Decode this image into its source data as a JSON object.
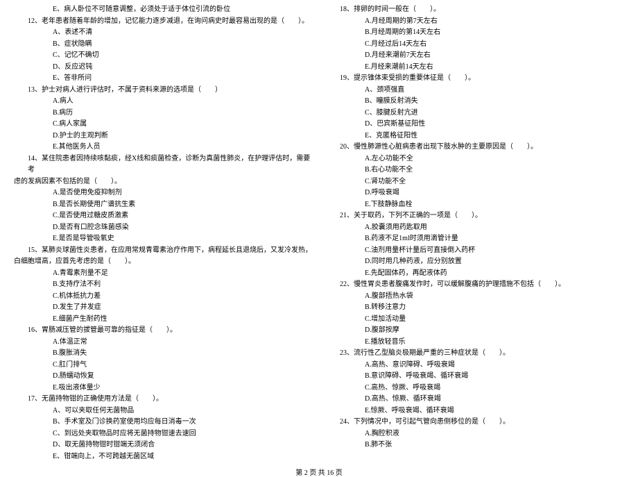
{
  "left": [
    {
      "type": "option",
      "text": "E、病人卧位不可随意调整，必须处于适于体位引流的卧位"
    },
    {
      "type": "question",
      "text": "12、老年患者随着年龄的增加，记忆能力逐步减退，在询问病史时最容易出现的是（　　）。"
    },
    {
      "type": "option",
      "text": "A、表述不清"
    },
    {
      "type": "option",
      "text": "B、症状隐瞒"
    },
    {
      "type": "option",
      "text": "C、记忆不确切"
    },
    {
      "type": "option",
      "text": "D、反应迟钝"
    },
    {
      "type": "option",
      "text": "E、答非所问"
    },
    {
      "type": "question",
      "text": "13、护士对病人进行评估时，不属于资料来源的选项是（　　）"
    },
    {
      "type": "option",
      "text": "A.病人"
    },
    {
      "type": "option",
      "text": "B.病历"
    },
    {
      "type": "option",
      "text": "C.病人家属"
    },
    {
      "type": "option",
      "text": "D.护士的主观判断"
    },
    {
      "type": "option",
      "text": "E.其他医务人员"
    },
    {
      "type": "question",
      "text": "14、某住院患者因持续咳黏痰，经X线和痰菌检查，诊断为真菌性肺炎，在护理评估时，需要考"
    },
    {
      "type": "continuation",
      "text": "虑的发病因素不包括的是（　　）。"
    },
    {
      "type": "option",
      "text": "A.是否使用免疫抑制剂"
    },
    {
      "type": "option",
      "text": "B.是否长期使用广谱抗生素"
    },
    {
      "type": "option",
      "text": "C.是否使用过糖皮质激素"
    },
    {
      "type": "option",
      "text": "D.是否有口腔念珠菌感染"
    },
    {
      "type": "option",
      "text": "E.是否是导管吸氧史"
    },
    {
      "type": "question",
      "text": "15、某肺炎球菌性炎患者，在应用常规青霉素治疗作用下，病程延长且退烧后，又发冷发热，"
    },
    {
      "type": "continuation",
      "text": "白细胞增高，应首先考虑的是（　　）。"
    },
    {
      "type": "option",
      "text": "A.青霉素剂量不足"
    },
    {
      "type": "option",
      "text": "B.支持疗法不利"
    },
    {
      "type": "option",
      "text": "C.机体抵抗力差"
    },
    {
      "type": "option",
      "text": "D.发生了并发症"
    },
    {
      "type": "option",
      "text": "E.细菌产生耐药性"
    },
    {
      "type": "question",
      "text": "16、胃肠减压管的拔管最可靠的指征是（　　）。"
    },
    {
      "type": "option",
      "text": "A.体温正常"
    },
    {
      "type": "option",
      "text": "B.腹胀消失"
    },
    {
      "type": "option",
      "text": "C.肛门排气"
    },
    {
      "type": "option",
      "text": "D.肠蠕动恢复"
    },
    {
      "type": "option",
      "text": "E.吸出液体量少"
    },
    {
      "type": "question",
      "text": "17、无菌持物钳的正确使用方法是（　　）。"
    },
    {
      "type": "option",
      "text": "A、可以夹取任何无菌物品"
    },
    {
      "type": "option",
      "text": "B、手术室及门诊换药室使用均应每日消毒一次"
    },
    {
      "type": "option",
      "text": "C、到远处夹取物品时应将无菌持物钳速去速回"
    },
    {
      "type": "option",
      "text": "D、取无菌持物钳时钳端无须闭合"
    },
    {
      "type": "option",
      "text": "E、钳端向上，不可跨越无菌区域"
    }
  ],
  "right": [
    {
      "type": "question",
      "text": "18、排卵的时间一般在（　　）。"
    },
    {
      "type": "option",
      "text": "A.月经周期的第7天左右"
    },
    {
      "type": "option",
      "text": "B.月经周期的第14天左右"
    },
    {
      "type": "option",
      "text": "C.月经过后14天左右"
    },
    {
      "type": "option",
      "text": "D.月经来潮前7天左右"
    },
    {
      "type": "option",
      "text": "E.月经来潮前14天左右"
    },
    {
      "type": "question",
      "text": "19、提示锥体束受损的重要体征是（　　）。"
    },
    {
      "type": "option",
      "text": "A、颈项强直"
    },
    {
      "type": "option",
      "text": "B、瞳膜反射消失"
    },
    {
      "type": "option",
      "text": "C、膝腱反射亢进"
    },
    {
      "type": "option",
      "text": "D、巴宾斯基征阳性"
    },
    {
      "type": "option",
      "text": "E、克匿格征阳性"
    },
    {
      "type": "question",
      "text": "20、慢性肺源性心脏病患者出现下肢水肿的主要原因是（　　）。"
    },
    {
      "type": "option",
      "text": "A.左心功能不全"
    },
    {
      "type": "option",
      "text": "B.右心功能不全"
    },
    {
      "type": "option",
      "text": "C.肾功能不全"
    },
    {
      "type": "option",
      "text": "D.呼吸衰竭"
    },
    {
      "type": "option",
      "text": "E.下肢静脉血栓"
    },
    {
      "type": "question",
      "text": "21、关于取药，下列不正确的一项是（　　）。"
    },
    {
      "type": "option",
      "text": "A.胶囊须用药匙取用"
    },
    {
      "type": "option",
      "text": "B.药液不足1ml时须用滴管计量"
    },
    {
      "type": "option",
      "text": "C.油剂用量杯计量后可直接倒入药杯"
    },
    {
      "type": "option",
      "text": "D.同时用几种药液，应分别放置"
    },
    {
      "type": "option",
      "text": "E.先配固体药，再配液体药"
    },
    {
      "type": "question",
      "text": "22、慢性胃炎患者腹痛发作时，可以缓解腹痛的护理措施不包括（　　）。"
    },
    {
      "type": "option",
      "text": "A.腹部捂热水袋"
    },
    {
      "type": "option",
      "text": "B.转移注意力"
    },
    {
      "type": "option",
      "text": "C.增加活动量"
    },
    {
      "type": "option",
      "text": "D.腹部按摩"
    },
    {
      "type": "option",
      "text": "E.播放轻音乐"
    },
    {
      "type": "question",
      "text": "23、流行性乙型脑炎极期最严重的三种症状是（　　）。"
    },
    {
      "type": "option",
      "text": "A.高热、意识障碍、呼吸衰竭"
    },
    {
      "type": "option",
      "text": "B.意识障碍、呼吸衰竭、循环衰竭"
    },
    {
      "type": "option",
      "text": "C.高热、惊厥、呼吸衰竭"
    },
    {
      "type": "option",
      "text": "D.高热、惊厥、循环衰竭"
    },
    {
      "type": "option",
      "text": "E.惊厥、呼吸衰竭、循环衰竭"
    },
    {
      "type": "question",
      "text": "24、下列情况中，可引起气管向患侧移位的是（　　）。"
    },
    {
      "type": "option",
      "text": "A.胸腔积液"
    },
    {
      "type": "option",
      "text": "B.肺不张"
    }
  ],
  "footer": "第 2 页 共 16 页"
}
